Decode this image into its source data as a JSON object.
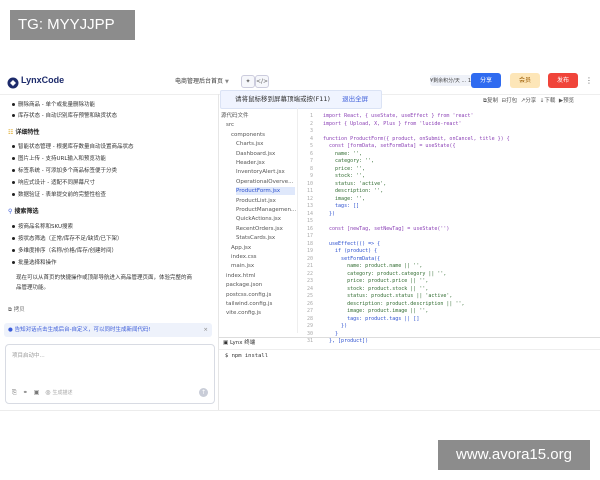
{
  "watermarks": {
    "top_left": "TG: MYYJJPP",
    "bottom_right": "www.avora15.org"
  },
  "header": {
    "app_name": "LynxCode",
    "project": "电商管理后台首页",
    "credits": "¥剩余积分/天 ... 10,000 T",
    "buttons": {
      "share": "分享",
      "member": "会员",
      "publish": "发布"
    }
  },
  "banner": {
    "text": "请将鼠标移到屏幕顶端或按(F11)",
    "exit": "退出全屏"
  },
  "editor_toolbar": {
    "items": [
      "复制",
      "打包",
      "分享",
      "下载",
      "预览"
    ]
  },
  "chat": {
    "block1": [
      "删除商品 - 单个或批量删除功能",
      "库存状态 - 自动识别库存预警和缺货状态"
    ],
    "heading1": "详细特性",
    "block2": [
      "智能状态管理 - 根据库存数量自动设置商品状态",
      "图片上传 - 支持URL输入和预览功能",
      "标签系统 - 可添加多个商品标签便于分类",
      "响应式设计 - 适配不同屏幕尺寸",
      "数据验证 - 表单提交前的完整性检查"
    ],
    "heading2": "搜索筛选",
    "block3": [
      "按商品名称和SKU搜索",
      "按状态筛选（正常/库存不足/缺货/已下架）",
      "多维度排序（名称/价格/库存/创建时间）",
      "批量选择和操作"
    ],
    "summary_1": "现在可以从首页的快捷操作或顶部导航进入商品管理页面，体验完整的商",
    "summary_2": "品管理功能。",
    "copy": "拷贝",
    "hint": "告知对话点击生成后台-自定义，可以同时生成新闻代码!",
    "input_placeholder": "项目启动中...",
    "input_tools_label": "生成描述"
  },
  "file_tree": [
    {
      "name": "源代码文件",
      "indent": 0
    },
    {
      "name": "src",
      "indent": 1
    },
    {
      "name": "components",
      "indent": 2
    },
    {
      "name": "Charts.jsx",
      "indent": 3
    },
    {
      "name": "Dashboard.jsx",
      "indent": 3
    },
    {
      "name": "Header.jsx",
      "indent": 3
    },
    {
      "name": "InventoryAlert.jsx",
      "indent": 3
    },
    {
      "name": "OperationalOverve...",
      "indent": 3
    },
    {
      "name": "ProductForm.jsx",
      "indent": 3,
      "selected": true
    },
    {
      "name": "ProductList.jsx",
      "indent": 3
    },
    {
      "name": "ProductManagemen...",
      "indent": 3
    },
    {
      "name": "QuickActions.jsx",
      "indent": 3
    },
    {
      "name": "RecentOrders.jsx",
      "indent": 3
    },
    {
      "name": "StatsCards.jsx",
      "indent": 3
    },
    {
      "name": "App.jsx",
      "indent": 2
    },
    {
      "name": "index.css",
      "indent": 2
    },
    {
      "name": "main.jsx",
      "indent": 2
    },
    {
      "name": "index.html",
      "indent": 1
    },
    {
      "name": "package.json",
      "indent": 1
    },
    {
      "name": "postcss.config.js",
      "indent": 1
    },
    {
      "name": "tailwind.config.js",
      "indent": 1
    },
    {
      "name": "vite.config.js",
      "indent": 1
    }
  ],
  "code_lines": [
    "import React, { useState, useEffect } from 'react'",
    "import { Upload, X, Plus } from 'lucide-react'",
    "",
    "function ProductForm({ product, onSubmit, onCancel, title }) {",
    "  const [formData, setFormData] = useState({",
    "    name: '',",
    "    category: '',",
    "    price: '',",
    "    stock: '',",
    "    status: 'active',",
    "    description: '',",
    "    image: '',",
    "    tags: []",
    "  })",
    "",
    "  const [newTag, setNewTag] = useState('')",
    "",
    "  useEffect(() => {",
    "    if (product) {",
    "      setFormData({",
    "        name: product.name || '',",
    "        category: product.category || '',",
    "        price: product.price || '',",
    "        stock: product.stock || '',",
    "        status: product.status || 'active',",
    "        description: product.description || '',",
    "        image: product.image || '',",
    "        tags: product.tags || []",
    "      })",
    "    }",
    "  }, [product])"
  ],
  "terminal": {
    "tab": "Lynx 终端",
    "command": "$ npm install"
  },
  "colors": {
    "accent": "#3a5bd9",
    "share": "#2f6bf0",
    "member": "#f5a623",
    "publish": "#f0443a"
  }
}
